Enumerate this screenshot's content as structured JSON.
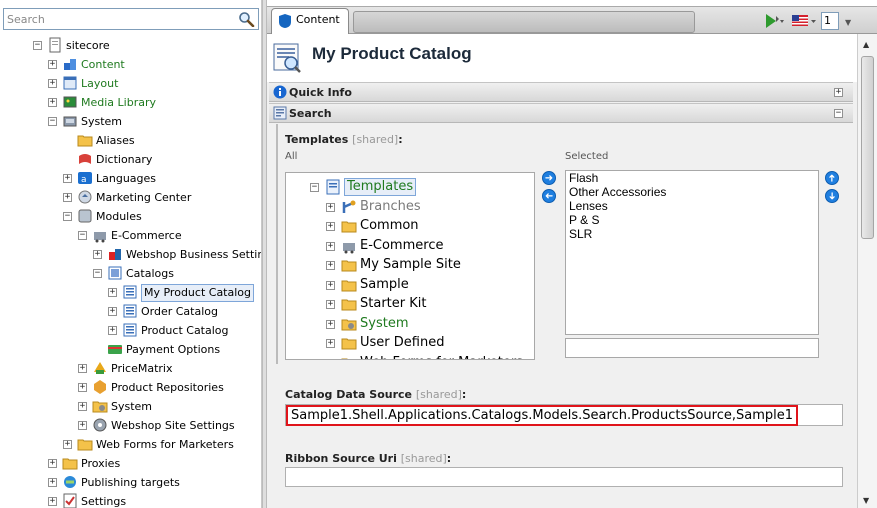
{
  "search": {
    "placeholder": "Search"
  },
  "tree": [
    {
      "label": "sitecore",
      "expanded": true,
      "icon": "document-icon"
    },
    {
      "label": "Content",
      "expanded": false,
      "icon": "content-icon"
    },
    {
      "label": "Layout",
      "expanded": false,
      "icon": "layout-icon"
    },
    {
      "label": "Media Library",
      "expanded": false,
      "icon": "media-library-icon"
    },
    {
      "label": "System",
      "expanded": true,
      "icon": "system-icon"
    },
    {
      "label": "Aliases",
      "icon": "folder-icon"
    },
    {
      "label": "Dictionary",
      "icon": "dictionary-icon"
    },
    {
      "label": "Languages",
      "expanded": false,
      "icon": "languages-icon"
    },
    {
      "label": "Marketing Center",
      "expanded": false,
      "icon": "marketing-center-icon"
    },
    {
      "label": "Modules",
      "expanded": true,
      "icon": "modules-icon"
    },
    {
      "label": "E-Commerce",
      "expanded": true,
      "icon": "ecommerce-icon"
    },
    {
      "label": "Webshop Business Setting",
      "expanded": false,
      "icon": "webshop-business-icon"
    },
    {
      "label": "Catalogs",
      "expanded": true,
      "icon": "catalogs-icon"
    },
    {
      "label": "My Product Catalog",
      "expanded": false,
      "icon": "catalog-icon",
      "selected": true
    },
    {
      "label": "Order Catalog",
      "expanded": false,
      "icon": "catalog-icon"
    },
    {
      "label": "Product Catalog",
      "expanded": false,
      "icon": "catalog-icon"
    },
    {
      "label": "Payment Options",
      "icon": "payment-options-icon"
    },
    {
      "label": "PriceMatrix",
      "expanded": false,
      "icon": "price-matrix-icon"
    },
    {
      "label": "Product Repositories",
      "expanded": false,
      "icon": "product-repositories-icon"
    },
    {
      "label": "System",
      "expanded": false,
      "icon": "system-folder-icon"
    },
    {
      "label": "Webshop Site Settings",
      "expanded": false,
      "icon": "webshop-settings-icon"
    },
    {
      "label": "Web Forms for Marketers",
      "expanded": false,
      "icon": "folder-icon"
    },
    {
      "label": "Proxies",
      "expanded": false,
      "icon": "folder-icon"
    },
    {
      "label": "Publishing targets",
      "expanded": false,
      "icon": "publishing-targets-icon"
    },
    {
      "label": "Settings",
      "expanded": false,
      "icon": "settings-icon"
    }
  ],
  "tab": {
    "label": "Content"
  },
  "toolbar": {
    "language_label": "1"
  },
  "item": {
    "title": "My Product Catalog"
  },
  "sections": {
    "quick_info": "Quick Info",
    "search": "Search"
  },
  "templates_field": {
    "label": "Templates",
    "shared": "[shared]",
    "colon": ":",
    "all_label": "All",
    "selected_label": "Selected",
    "tree": [
      {
        "label": "Templates",
        "expanded": true,
        "icon": "templates-icon",
        "selected": true
      },
      {
        "label": "Branches",
        "expanded": false,
        "icon": "branches-icon",
        "muted": true
      },
      {
        "label": "Common",
        "expanded": false,
        "icon": "folder-icon"
      },
      {
        "label": "E-Commerce",
        "expanded": false,
        "icon": "ecommerce-icon"
      },
      {
        "label": "My Sample Site",
        "expanded": false,
        "icon": "folder-icon"
      },
      {
        "label": "Sample",
        "expanded": false,
        "icon": "folder-icon"
      },
      {
        "label": "Starter Kit",
        "expanded": false,
        "icon": "folder-icon"
      },
      {
        "label": "System",
        "expanded": false,
        "icon": "system-folder-icon",
        "green": true
      },
      {
        "label": "User Defined",
        "expanded": false,
        "icon": "folder-icon"
      },
      {
        "label": "Web Forms for Marketers",
        "expanded": false,
        "icon": "folder-icon"
      }
    ],
    "selected_items": [
      "Flash",
      "Other Accessories",
      "Lenses",
      "P & S",
      "SLR"
    ]
  },
  "catalog_data_source": {
    "label": "Catalog Data Source",
    "shared": "[shared]",
    "colon": ":",
    "value": "Sample1.Shell.Applications.Catalogs.Models.Search.ProductsSource,Sample1"
  },
  "ribbon_source_uri": {
    "label": "Ribbon Source Uri",
    "shared": "[shared]",
    "colon": ":",
    "value": ""
  },
  "colors": {
    "accent": "#1f7fe0",
    "highlight_border": "#e0141b",
    "green_text": "#1f7a1f"
  }
}
